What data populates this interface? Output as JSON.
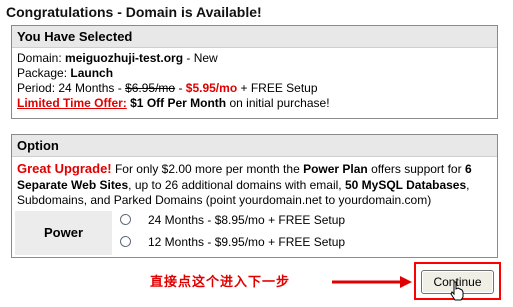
{
  "page_title": "Congratulations - Domain is Available!",
  "selected": {
    "heading": "You Have Selected",
    "domain_label": "Domain: ",
    "domain_name": "meiguozhuji-test.org",
    "domain_suffix": " - New",
    "package_label": "Package: ",
    "package_name": "Launch",
    "period_label": "Period: 24 Months - ",
    "old_price": "$6.95/mo",
    "price_sep": " - ",
    "new_price": "$5.95/mo",
    "period_suffix": " + FREE Setup",
    "offer_label": "Limited Time Offer:",
    "offer_value": " $1 Off Per Month",
    "offer_suffix": " on initial purchase!"
  },
  "option": {
    "heading": "Option",
    "upgrade_label": "Great Upgrade!",
    "text_1": " For only $2.00 more per month the ",
    "plan_bold": "Power Plan",
    "text_2": " offers support for ",
    "sites_bold": "6 Separate Web Sites",
    "text_3": ", up to 26 additional domains with email, ",
    "db_bold": "50 MySQL Databases",
    "text_4": ", Subdomains, and Parked Domains (point yourdomain.net to yourdomain.com)",
    "plan_name": "Power",
    "choices": [
      {
        "label": "24 Months - $8.95/mo + FREE Setup",
        "checked": false
      },
      {
        "label": "12 Months - $9.95/mo + FREE Setup",
        "checked": false
      }
    ]
  },
  "annotation_text": "直接点这个进入下一步",
  "continue_label": "Continue",
  "colors": {
    "accent_red": "#e00000",
    "header_gray": "#e8e8e8"
  }
}
